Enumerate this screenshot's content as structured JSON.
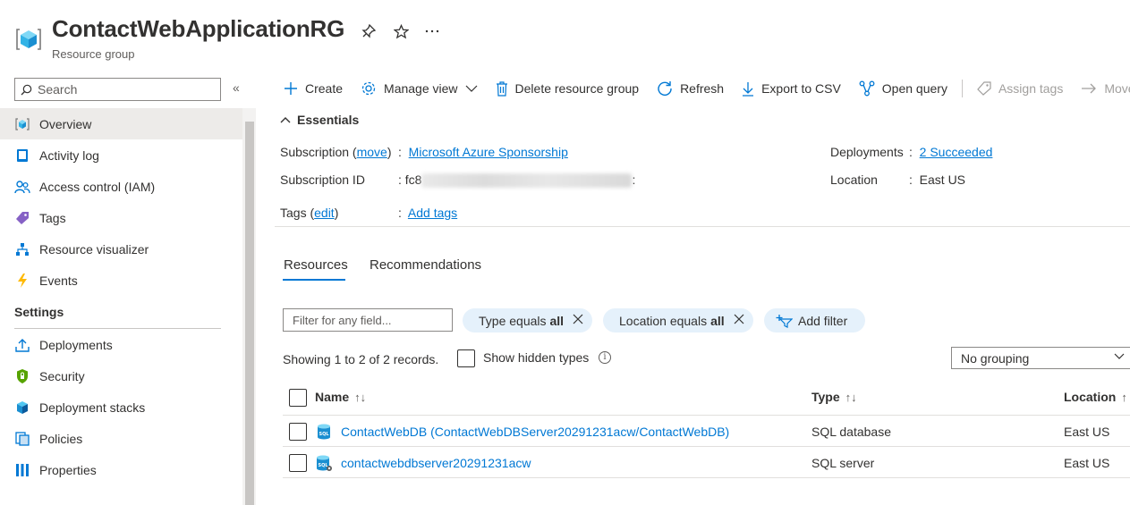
{
  "header": {
    "title": "ContactWebApplicationRG",
    "subtitle": "Resource group"
  },
  "sidebar": {
    "search_placeholder": "Search",
    "collapse_glyph": "«",
    "items": [
      {
        "label": "Overview",
        "icon": "overview-icon",
        "active": true
      },
      {
        "label": "Activity log",
        "icon": "activity-log-icon"
      },
      {
        "label": "Access control (IAM)",
        "icon": "people-icon"
      },
      {
        "label": "Tags",
        "icon": "tag-icon"
      },
      {
        "label": "Resource visualizer",
        "icon": "visualizer-icon"
      },
      {
        "label": "Events",
        "icon": "lightning-icon"
      }
    ],
    "settings_heading": "Settings",
    "settings_items": [
      {
        "label": "Deployments",
        "icon": "upload-icon"
      },
      {
        "label": "Security",
        "icon": "shield-icon"
      },
      {
        "label": "Deployment stacks",
        "icon": "stack-icon"
      },
      {
        "label": "Policies",
        "icon": "policy-icon"
      },
      {
        "label": "Properties",
        "icon": "properties-icon"
      }
    ]
  },
  "toolbar": {
    "create": "Create",
    "manage_view": "Manage view",
    "delete": "Delete resource group",
    "refresh": "Refresh",
    "export": "Export to CSV",
    "open_query": "Open query",
    "assign_tags": "Assign tags",
    "move": "Move"
  },
  "essentials": {
    "heading": "Essentials",
    "subscription_label": "Subscription (",
    "subscription_move": "move",
    "subscription_label_end": ")",
    "subscription_value": "Microsoft Azure Sponsorship",
    "subscription_id_label": "Subscription ID",
    "subscription_id_value": "fc8",
    "tags_label": "Tags (",
    "tags_edit": "edit",
    "tags_label_end": ")",
    "tags_value": "Add tags",
    "deployments_label": "Deployments",
    "deployments_value": "2 Succeeded",
    "location_label": "Location",
    "location_value": "East US",
    "separator": ":"
  },
  "tabs": {
    "resources": "Resources",
    "recommendations": "Recommendations"
  },
  "filters": {
    "placeholder": "Filter for any field...",
    "type_pill": "Type equals",
    "type_value": "all",
    "location_pill": "Location equals",
    "location_value": "all",
    "add_filter": "Add filter"
  },
  "list": {
    "showing": "Showing 1 to 2 of 2 records.",
    "show_hidden": "Show hidden types",
    "grouping": "No grouping",
    "columns": {
      "name": "Name",
      "type": "Type",
      "location": "Location"
    },
    "rows": [
      {
        "name": "ContactWebDB (ContactWebDBServer20291231acw/ContactWebDB)",
        "type": "SQL database",
        "location": "East US",
        "icon": "sql-database-icon"
      },
      {
        "name": "contactwebdbserver20291231acw",
        "type": "SQL server",
        "location": "East US",
        "icon": "sql-server-icon"
      }
    ]
  },
  "colors": {
    "accent": "#0078d4",
    "pill_bg": "#e5f1fb"
  }
}
